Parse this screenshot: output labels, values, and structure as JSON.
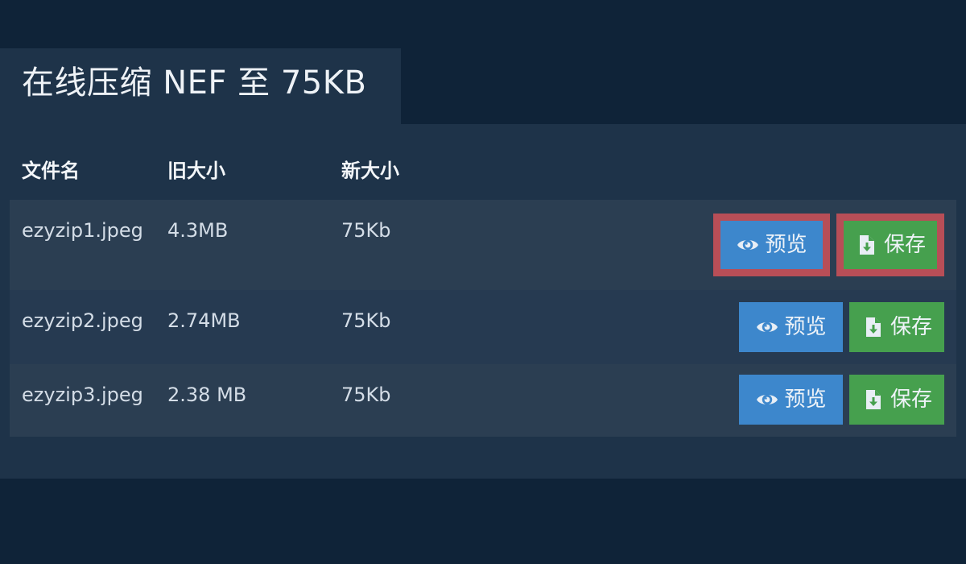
{
  "header": {
    "title": "在线压缩 NEF 至 75KB"
  },
  "table": {
    "columns": [
      "文件名",
      "旧大小",
      "新大小"
    ],
    "rows": [
      {
        "filename": "ezyzip1.jpeg",
        "old_size": "4.3MB",
        "new_size": "75Kb",
        "highlighted": true
      },
      {
        "filename": "ezyzip2.jpeg",
        "old_size": "2.74MB",
        "new_size": "75Kb",
        "highlighted": false
      },
      {
        "filename": "ezyzip3.jpeg",
        "old_size": "2.38 MB",
        "new_size": "75Kb",
        "highlighted": false
      }
    ]
  },
  "buttons": {
    "preview_label": "预览",
    "save_label": "保存",
    "preview_icon": "eye-icon",
    "save_icon": "file-download-icon"
  },
  "colors": {
    "page_background": "#0f2338",
    "panel_background": "#1e3349",
    "preview_button": "#3d87cc",
    "save_button": "#46a04e",
    "highlight_border": "#b84e57"
  }
}
